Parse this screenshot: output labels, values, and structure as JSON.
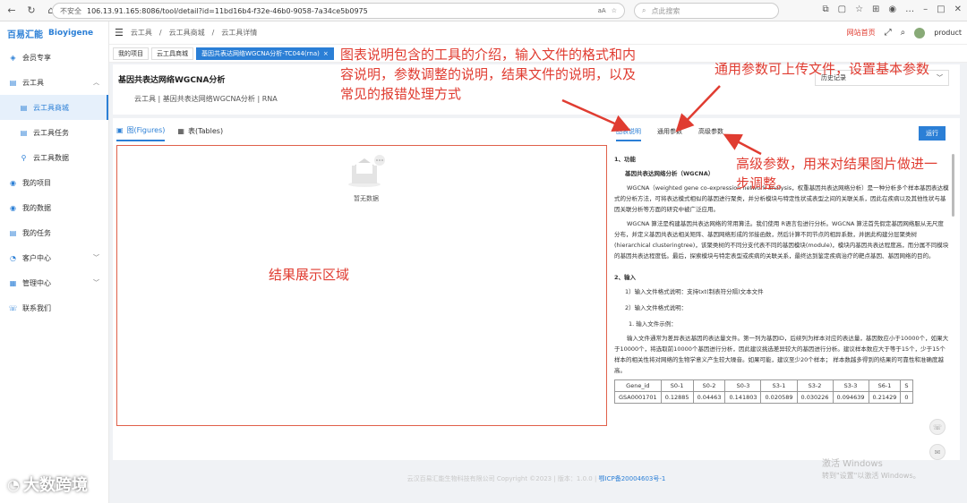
{
  "browser": {
    "security": "不安全",
    "url": "106.13.91.165:8086/tool/detail?id=11bd16b4-f32e-46b0-9058-7a34ce5b0975",
    "search_placeholder": "点此搜索"
  },
  "logo": {
    "cn": "百易汇能",
    "en": "Bioyigene"
  },
  "sidebar": {
    "items": [
      {
        "label": "会员专享",
        "icon": "member-icon"
      },
      {
        "label": "云工具",
        "icon": "cloud-tool-icon"
      },
      {
        "label": "云工具商城",
        "icon": "store-icon"
      },
      {
        "label": "云工具任务",
        "icon": "task-icon"
      },
      {
        "label": "云工具数据",
        "icon": "data-icon"
      },
      {
        "label": "我的项目",
        "icon": "project-icon"
      },
      {
        "label": "我的数据",
        "icon": "my-data-icon"
      },
      {
        "label": "我的任务",
        "icon": "my-task-icon"
      },
      {
        "label": "客户中心",
        "icon": "customer-icon"
      },
      {
        "label": "管理中心",
        "icon": "manage-icon"
      },
      {
        "label": "联系我们",
        "icon": "contact-icon"
      }
    ]
  },
  "topnav": {
    "crumb1": "云工具",
    "crumb2": "云工具商城",
    "crumb3": "云工具详情",
    "home": "网站首页",
    "user": "product"
  },
  "tabs": [
    {
      "label": "我的项目"
    },
    {
      "label": "云工具商城"
    },
    {
      "label": "基因共表达网络WGCNA分析-TC044(rna)"
    }
  ],
  "header": {
    "title": "基因共表达网络WGCNA分析",
    "subtitle": "云工具 | 基因共表达网络WGCNA分析 | RNA",
    "history": "历史记录"
  },
  "left": {
    "tab_figures": "图(Figures)",
    "tab_tables": "表(Tables)",
    "empty": "暂无数据"
  },
  "right": {
    "tabs": [
      "图表说明",
      "通用参数",
      "高级参数"
    ],
    "run": "运行",
    "doc": {
      "s1": "1、功能",
      "s1_title": "基因共表达网络分析（WGCNA）",
      "p1": "WGCNA（weighted gene co-expression network analysis，权重基因共表达网络分析）是一种分析多个样本基因表达模式的分析方法，可将表达模式相似的基因进行聚类，并分析模块与特定性状或表型之间的关联关系，因此在疾病以及其他性状与基因关联分析等方面的研究中被广泛应用。",
      "p2": "WGCNA 算法是构建基因共表达网络的常用算法。我们使用 R语言包进行分析。WGCNA 算法首先假定基因网络服从无尺度分布，并定义基因共表达相关矩阵、基因网络形成的邻接函数，然后计算不同节点的相异系数，并据此构建分层聚类树(hierarchical clusteringtree)，该聚类树的不同分支代表不同的基因模块(module)，模块内基因共表达程度高，而分属不同模块的基因共表达程度低。最后，探索模块与特定表型或疾病的关联关系，最终达到鉴定疾病治疗的靶点基因、基因网络的目的。",
      "s2": "2、输入",
      "in1": "1）输入文件格式说明：支持txt(制表符分隔)文本文件",
      "in2": "2）输入文件格式说明：",
      "in3": "1. 输入文件示例：",
      "p3": "输入文件通常为差异表达基因的表达量文件。第一列为基因ID，后续列为样本对应的表达量，基因数应小于10000个，如果大于10000个，将选取前10000个基因进行分析，因此建议挑选差异较大的基因进行分析。建议样本数应大于等于15个，少于15个样本的相关性将对网络的生物学意义产生较大噪音。如果可能，建议至少20个样本； 样本数越多得到的结果的可靠性和准确度越高。",
      "table_header": [
        "Gene_id",
        "S0-1",
        "S0-2",
        "S0-3",
        "S3-1",
        "S3-2",
        "S3-3",
        "S6-1",
        "S"
      ],
      "table_row": [
        "GSA0001701",
        "0.12885",
        "0.04463",
        "0.141803",
        "0.020589",
        "0.030226",
        "0.094639",
        "0.21429",
        "0"
      ]
    }
  },
  "footer": {
    "copy": "云汉百易汇能生物科技有限公司 Copyright ©2023 | 版本：1.0.0 |",
    "icp": "鄂ICP备20004603号-1"
  },
  "annotations": {
    "a1": "图表说明包含的工具的介绍，输入文件的格式和内容说明，参数调整的说明，结果文件的说明，以及常见的报错处理方式",
    "a2": "通用参数可上传文件，设置基本参数",
    "a3": "高级参数，用来对结果图片做进一步调整。",
    "a4": "结果展示区域"
  },
  "windows": {
    "l1": "激活 Windows",
    "l2": "转到\"设置\"以激活 Windows。"
  },
  "watermark": "大数跨境"
}
